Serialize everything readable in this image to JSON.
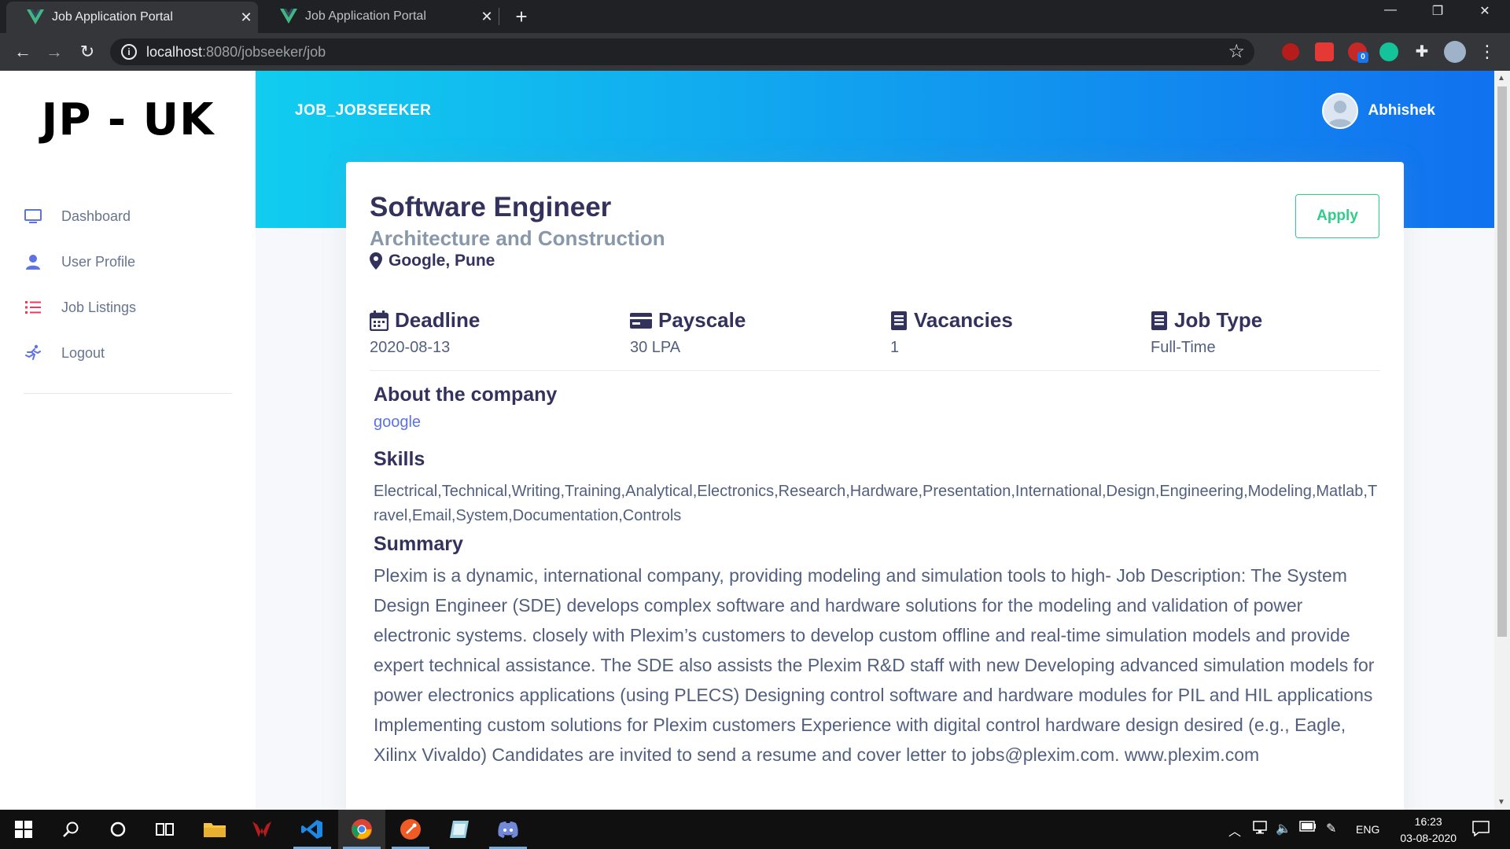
{
  "browser": {
    "tabs": [
      {
        "label": "Job Application Portal",
        "active": true
      },
      {
        "label": "Job Application Portal",
        "active": false
      }
    ],
    "url_host": "localhost",
    "url_path": ":8080/jobseeker/job",
    "extension_badge": "0"
  },
  "sidebar": {
    "brand": "JP - UK",
    "items": [
      {
        "label": "Dashboard",
        "icon": "monitor-icon"
      },
      {
        "label": "User Profile",
        "icon": "user-icon"
      },
      {
        "label": "Job Listings",
        "icon": "list-icon"
      },
      {
        "label": "Logout",
        "icon": "run-icon"
      }
    ]
  },
  "header": {
    "title": "JOB_JOBSEEKER",
    "username": "Abhishek"
  },
  "job": {
    "title": "Software Engineer",
    "category": "Architecture and Construction",
    "location": "Google, Pune",
    "apply_label": "Apply",
    "stats": [
      {
        "label": "Deadline",
        "value": "2020-08-13",
        "icon": "calendar-icon"
      },
      {
        "label": "Payscale",
        "value": "30 LPA",
        "icon": "money-icon"
      },
      {
        "label": "Vacancies",
        "value": "1",
        "icon": "book-icon"
      },
      {
        "label": "Job Type",
        "value": "Full-Time",
        "icon": "book-icon"
      }
    ],
    "about_heading": "About the company",
    "company": "google",
    "skills_heading": "Skills",
    "skills": "Electrical,Technical,Writing,Training,Analytical,Electronics,Research,Hardware,Presentation,International,Design,Engineering,Modeling,Matlab,Travel,Email,System,Documentation,Controls",
    "summary_heading": "Summary",
    "summary": "Plexim is a dynamic, international company, providing modeling and simulation tools to high- Job Description: The System Design Engineer (SDE) develops complex software and hardware solutions for the modeling and validation of power electronic systems. closely with Plexim’s customers to develop custom offline and real-time simulation models and provide expert technical assistance. The SDE also assists the Plexim R&D staff with new Developing advanced simulation models for power electronics applications (using PLECS) Designing control software and hardware modules for PIL and HIL applications Implementing custom solutions for Plexim customers Experience with digital control hardware design desired (e.g., Eagle, Xilinx Vivaldo) Candidates are invited to send a resume and cover letter to jobs@plexim.com. www.plexim.com"
  },
  "taskbar": {
    "language": "ENG",
    "time": "16:23",
    "date": "03-08-2020"
  },
  "colors": {
    "header_start": "#11cdef",
    "header_end": "#1171ef",
    "apply": "#2dce89",
    "link": "#5e72e4"
  }
}
